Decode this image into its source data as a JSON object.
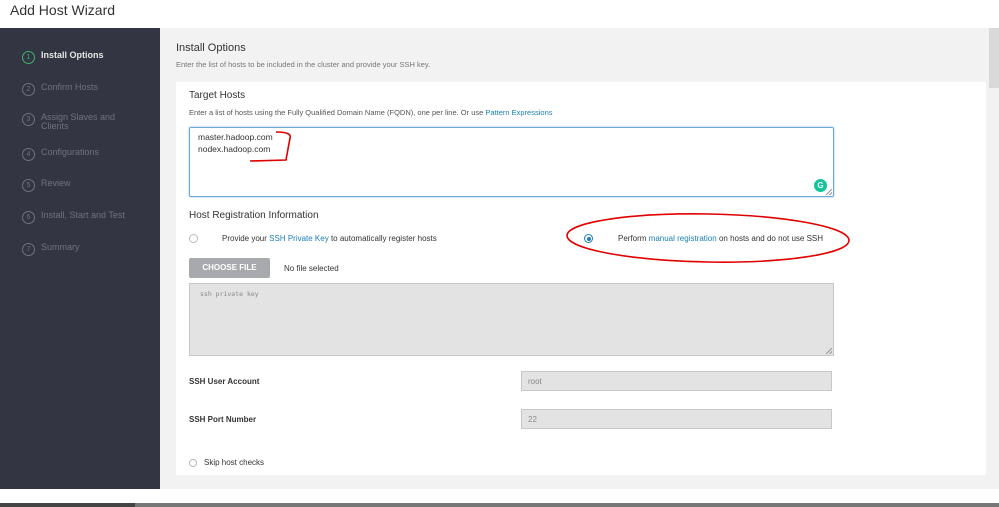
{
  "window": {
    "title": "Add Host Wizard"
  },
  "sidebar": {
    "steps": [
      {
        "num": "1",
        "label": "Install Options",
        "active": true
      },
      {
        "num": "2",
        "label": "Confirm Hosts"
      },
      {
        "num": "3",
        "label": "Assign Slaves and Clients"
      },
      {
        "num": "4",
        "label": "Configurations"
      },
      {
        "num": "5",
        "label": "Review"
      },
      {
        "num": "6",
        "label": "Install, Start and Test"
      },
      {
        "num": "7",
        "label": "Summary"
      }
    ]
  },
  "main": {
    "title": "Install Options",
    "subtitle": "Enter the list of hosts to be included in the cluster and provide your SSH key.",
    "target_hosts": {
      "heading": "Target Hosts",
      "desc_prefix": "Enter a list of hosts using the Fully Qualified Domain Name (FQDN), one per line. Or use ",
      "desc_link": "Pattern Expressions",
      "lines": [
        "master.hadoop.com",
        "nodex.hadoop.com"
      ]
    },
    "registration": {
      "heading": "Host Registration Information",
      "option_ssh": {
        "prefix": "Provide your ",
        "link": "SSH Private Key",
        "suffix": " to automatically register hosts",
        "selected": false
      },
      "option_manual": {
        "prefix": "Perform ",
        "link": "manual registration",
        "suffix": " on hosts and do not use SSH",
        "selected": true
      },
      "choose_file_label": "CHOOSE FILE",
      "no_file_text": "No file selected",
      "key_placeholder": "ssh private key"
    },
    "ssh_user": {
      "label": "SSH User Account",
      "value": "root"
    },
    "ssh_port": {
      "label": "SSH Port Number",
      "value": "22"
    },
    "skip_checks_label": "Skip host checks"
  },
  "colors": {
    "accent": "#1a7fb5",
    "sidebar_bg": "#333642",
    "active_step": "#3cb371",
    "annotation": "#e00000"
  }
}
